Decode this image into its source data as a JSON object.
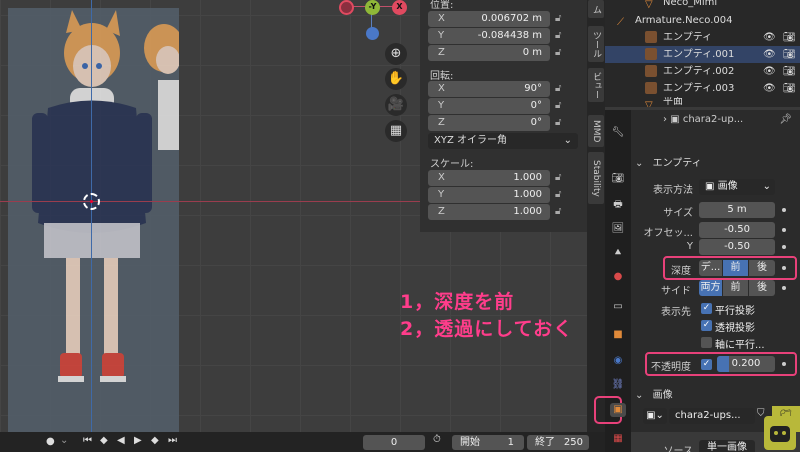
{
  "npanel": {
    "location_label": "位置:",
    "location": [
      {
        "axis": "X",
        "value": "0.006702 m"
      },
      {
        "axis": "Y",
        "value": "-0.084438 m"
      },
      {
        "axis": "Z",
        "value": "0 m"
      }
    ],
    "rotation_label": "回転:",
    "rotation": [
      {
        "axis": "X",
        "value": "90°"
      },
      {
        "axis": "Y",
        "value": "0°"
      },
      {
        "axis": "Z",
        "value": "0°"
      }
    ],
    "rotation_mode": "XYZ オイラー角",
    "scale_label": "スケール:",
    "scale": [
      {
        "axis": "X",
        "value": "1.000"
      },
      {
        "axis": "Y",
        "value": "1.000"
      },
      {
        "axis": "Z",
        "value": "1.000"
      }
    ]
  },
  "gizmo": {
    "neg_y": "-Y",
    "x": "X"
  },
  "vtabs": [
    "ム",
    "ツール",
    "ビュー",
    "MMD",
    "Stability"
  ],
  "outliner": {
    "rows": [
      {
        "name": "Neco_Mimi",
        "color": "#e08a3a"
      },
      {
        "name": "Armature.Neco.004",
        "color": "#e08a3a"
      },
      {
        "name": "エンプティ",
        "color": "#e08a3a"
      },
      {
        "name": "エンプティ.001",
        "color": "#e08a3a"
      },
      {
        "name": "エンプティ.002",
        "color": "#e08a3a"
      },
      {
        "name": "エンプティ.003",
        "color": "#e08a3a"
      },
      {
        "name": "平面",
        "color": "#e08a3a"
      }
    ]
  },
  "props": {
    "header_name": "chara2-up...",
    "section_empty": "エンプティ",
    "display_label": "表示方法",
    "display_value": "画像",
    "size_label": "サイズ",
    "size_value": "5 m",
    "offset_label": "オフセッ...",
    "offset_x": "-0.50",
    "offset_y_label": "Y",
    "offset_y": "-0.50",
    "depth_label": "深度",
    "depth_options": [
      "デ...",
      "前",
      "後"
    ],
    "side_label": "サイド",
    "side_options": [
      "両方",
      "前",
      "後"
    ],
    "show_label": "表示先",
    "show_ortho": "平行投影",
    "show_persp": "透視投影",
    "show_axis": "軸に平行...",
    "opacity_label": "不透明度",
    "opacity_value": "0.200",
    "section_image": "画像",
    "image_name": "chara2-ups...",
    "source_label": "ソース",
    "source_value": "単一画像"
  },
  "timeline": {
    "frame": "0",
    "start_label": "開始",
    "start": "1",
    "end_label": "終了",
    "end": "250"
  },
  "annotation": {
    "line1": "1，深度を前",
    "line2": "2，透過にしておく"
  },
  "colors": {
    "accent": "#4772b3",
    "highlight": "#e8417a",
    "annotation": "#ff3d8b"
  }
}
